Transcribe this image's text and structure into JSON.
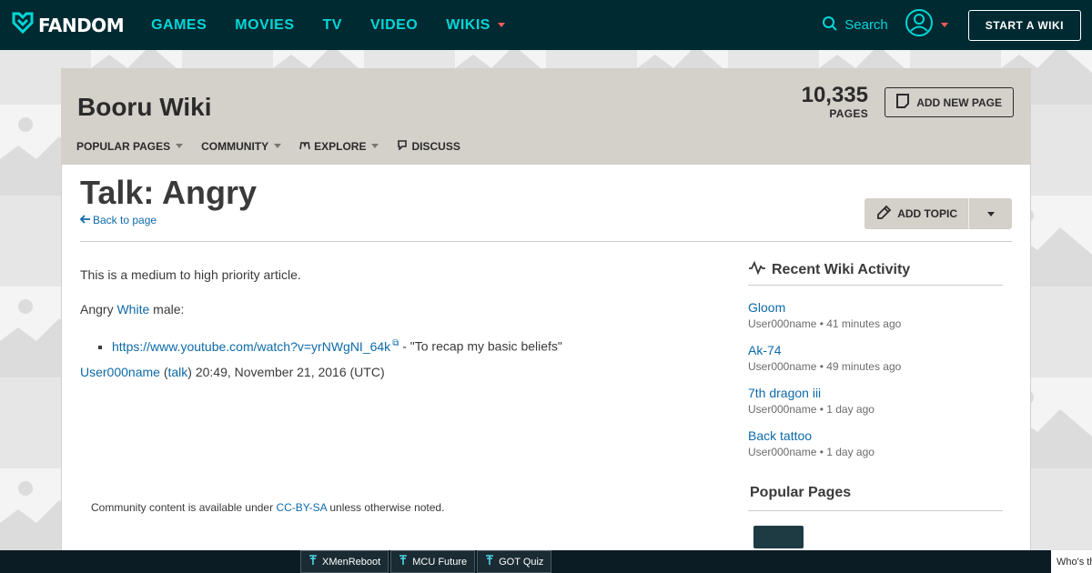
{
  "global_nav": {
    "logo_text": "FANDOM",
    "links": [
      {
        "label": "GAMES"
      },
      {
        "label": "MOVIES"
      },
      {
        "label": "TV"
      },
      {
        "label": "VIDEO"
      },
      {
        "label": "WIKIS",
        "dropdown": true
      }
    ],
    "search_label": "Search",
    "start_wiki_label": "START A WIKI"
  },
  "community_header": {
    "wiki_name": "Booru Wiki",
    "page_count": "10,335",
    "page_count_label": "PAGES",
    "add_new_page_label": "ADD NEW PAGE",
    "tabs": [
      {
        "label": "POPULAR PAGES"
      },
      {
        "label": "COMMUNITY"
      },
      {
        "label": "EXPLORE"
      },
      {
        "label": "DISCUSS"
      }
    ]
  },
  "page_header": {
    "title": "Talk: Angry",
    "back_link": "Back to page",
    "add_topic_label": "ADD TOPIC"
  },
  "article": {
    "priority_text": "This is a medium to high priority article.",
    "line2_prefix": "Angry ",
    "line2_link": "White",
    "line2_suffix": " male:",
    "bullet_link": "https://www.youtube.com/watch?v=yrNWgNI_64k",
    "bullet_suffix": " - \"To recap my basic beliefs\"",
    "signature_user": "User000name",
    "signature_open": " (",
    "signature_talk": "talk",
    "signature_rest": ") 20:49, November 21, 2016 (UTC)"
  },
  "license": {
    "prefix": "Community content is available under ",
    "link": "CC-BY-SA",
    "suffix": " unless otherwise noted."
  },
  "right_rail": {
    "activity_heading": "Recent Wiki Activity",
    "activity": [
      {
        "title": "Gloom",
        "meta": "User000name • 41 minutes ago"
      },
      {
        "title": "Ak-74",
        "meta": "User000name • 49 minutes ago"
      },
      {
        "title": "7th dragon iii",
        "meta": "User000name • 1 day ago"
      },
      {
        "title": "Back tattoo",
        "meta": "User000name • 1 day ago"
      }
    ],
    "popular_heading": "Popular Pages"
  },
  "bottom_bar": {
    "links": [
      {
        "label": "XMenReboot"
      },
      {
        "label": "MCU Future"
      },
      {
        "label": "GOT Quiz"
      }
    ],
    "right_text": "Who's th"
  },
  "colors": {
    "nav_bg": "#002a32",
    "nav_link": "#00d6d6",
    "caret": "#fe5b5b",
    "header_bg": "#d4d0ca",
    "link": "#0e6aa9"
  }
}
